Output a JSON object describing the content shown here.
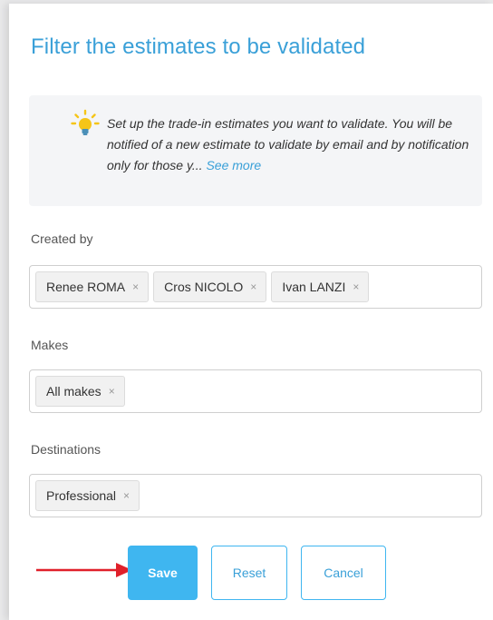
{
  "panel": {
    "title": "Filter the estimates to be validated"
  },
  "info": {
    "icon": "lightbulb-icon",
    "text": "Set up the trade-in estimates you want to validate. You will be notified of a new estimate to validate by email and by notification only for those y...",
    "see_more": "See more"
  },
  "created_by": {
    "label": "Created by",
    "chips": [
      "Renee ROMA",
      "Cros NICOLO",
      "Ivan LANZI"
    ]
  },
  "makes": {
    "label": "Makes",
    "chips": [
      "All makes"
    ]
  },
  "destinations": {
    "label": "Destinations",
    "chips": [
      "Professional"
    ]
  },
  "chip_remove_glyph": "×",
  "buttons": {
    "save": "Save",
    "reset": "Reset",
    "cancel": "Cancel"
  },
  "colors": {
    "accent": "#3aa0d8",
    "primary_button": "#3fb6f0",
    "annotation_arrow": "#e0202a",
    "bulb": "#f5c518"
  }
}
